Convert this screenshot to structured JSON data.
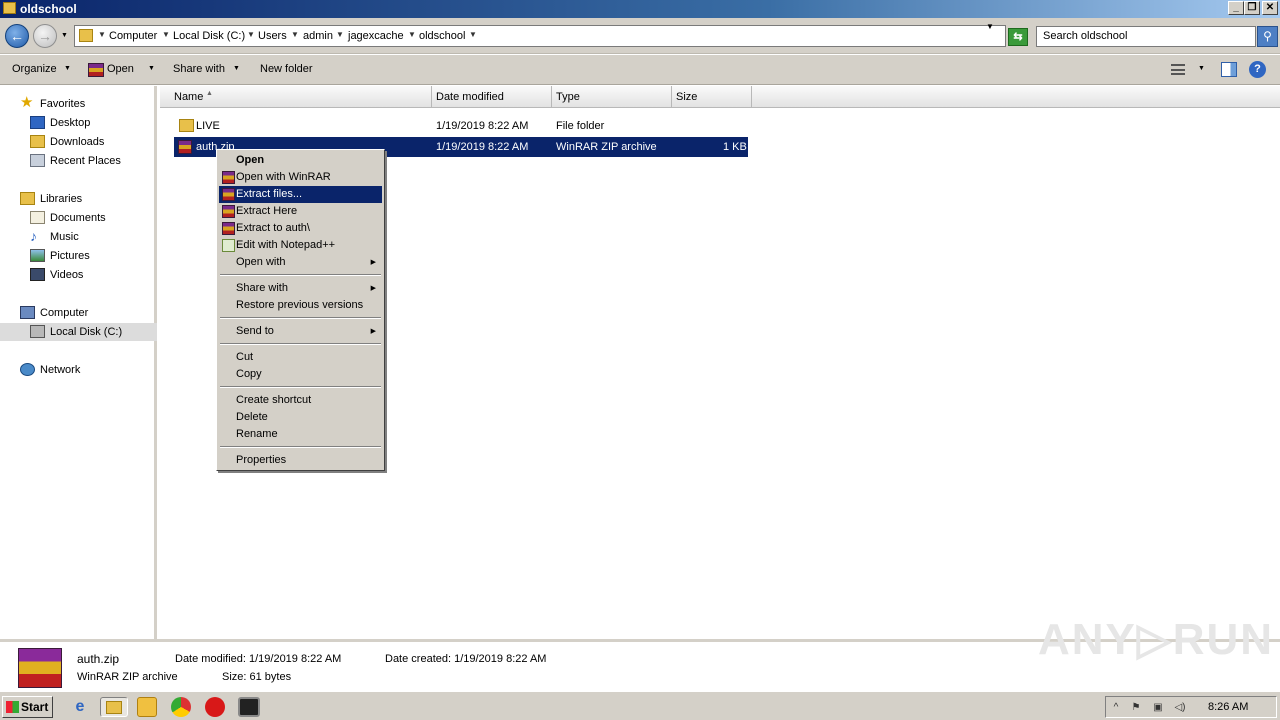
{
  "window": {
    "title": "oldschool"
  },
  "address": {
    "crumbs": [
      "Computer",
      "Local Disk (C:)",
      "Users",
      "admin",
      "jagexcache",
      "oldschool"
    ],
    "search_placeholder": "Search oldschool"
  },
  "toolbar": {
    "organize": "Organize",
    "open": "Open",
    "share_with": "Share with",
    "new_folder": "New folder"
  },
  "nav": {
    "favorites": "Favorites",
    "desktop": "Desktop",
    "downloads": "Downloads",
    "recent_places": "Recent Places",
    "libraries": "Libraries",
    "documents": "Documents",
    "music": "Music",
    "pictures": "Pictures",
    "videos": "Videos",
    "computer": "Computer",
    "local_disk": "Local Disk (C:)",
    "network": "Network"
  },
  "columns": {
    "name": "Name",
    "date": "Date modified",
    "type": "Type",
    "size": "Size"
  },
  "files": [
    {
      "name": "LIVE",
      "date": "1/19/2019 8:22 AM",
      "type": "File folder",
      "size": ""
    },
    {
      "name": "auth.zip",
      "date": "1/19/2019 8:22 AM",
      "type": "WinRAR ZIP archive",
      "size": "1 KB"
    }
  ],
  "context_menu": {
    "open": "Open",
    "open_with_winrar": "Open with WinRAR",
    "extract_files": "Extract files...",
    "extract_here": "Extract Here",
    "extract_to": "Extract to auth\\",
    "edit_notepad": "Edit with Notepad++",
    "open_with": "Open with",
    "share_with": "Share with",
    "restore_previous": "Restore previous versions",
    "send_to": "Send to",
    "cut": "Cut",
    "copy": "Copy",
    "create_shortcut": "Create shortcut",
    "delete": "Delete",
    "rename": "Rename",
    "properties": "Properties"
  },
  "details": {
    "name": "auth.zip",
    "type": "WinRAR ZIP archive",
    "date_modified": "Date modified:  1/19/2019 8:22 AM",
    "date_created": "Date created:  1/19/2019 8:22 AM",
    "size": "Size:  61 bytes",
    "watermark": "ANY▷RUN"
  },
  "taskbar": {
    "start": "Start",
    "clock": "8:26 AM"
  },
  "colors": {
    "selection": "#0a246a",
    "chrome": "#d4d0c8"
  }
}
